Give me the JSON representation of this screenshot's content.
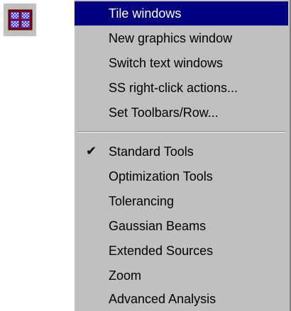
{
  "toolbar_button": {
    "icon": "tile-windows-icon"
  },
  "menu": {
    "items_top": [
      {
        "label": "Tile windows",
        "highlighted": true
      },
      {
        "label": "New graphics window"
      },
      {
        "label": "Switch text windows"
      },
      {
        "label": "SS right-click actions..."
      },
      {
        "label": "Set Toolbars/Row..."
      }
    ],
    "items_bottom": [
      {
        "label": "Standard Tools",
        "checked": true,
        "check": "✔"
      },
      {
        "label": "Optimization Tools"
      },
      {
        "label": "Tolerancing"
      },
      {
        "label": "Gaussian Beams"
      },
      {
        "label": "Extended Sources"
      },
      {
        "label": "Zoom"
      },
      {
        "label": "Advanced Analysis"
      }
    ]
  },
  "colors": {
    "menu_background": "#c0c0c0",
    "highlight": "#000080",
    "highlight_text": "#ffffff",
    "icon_frame": "#800000",
    "icon_cells": "#4040ff"
  }
}
